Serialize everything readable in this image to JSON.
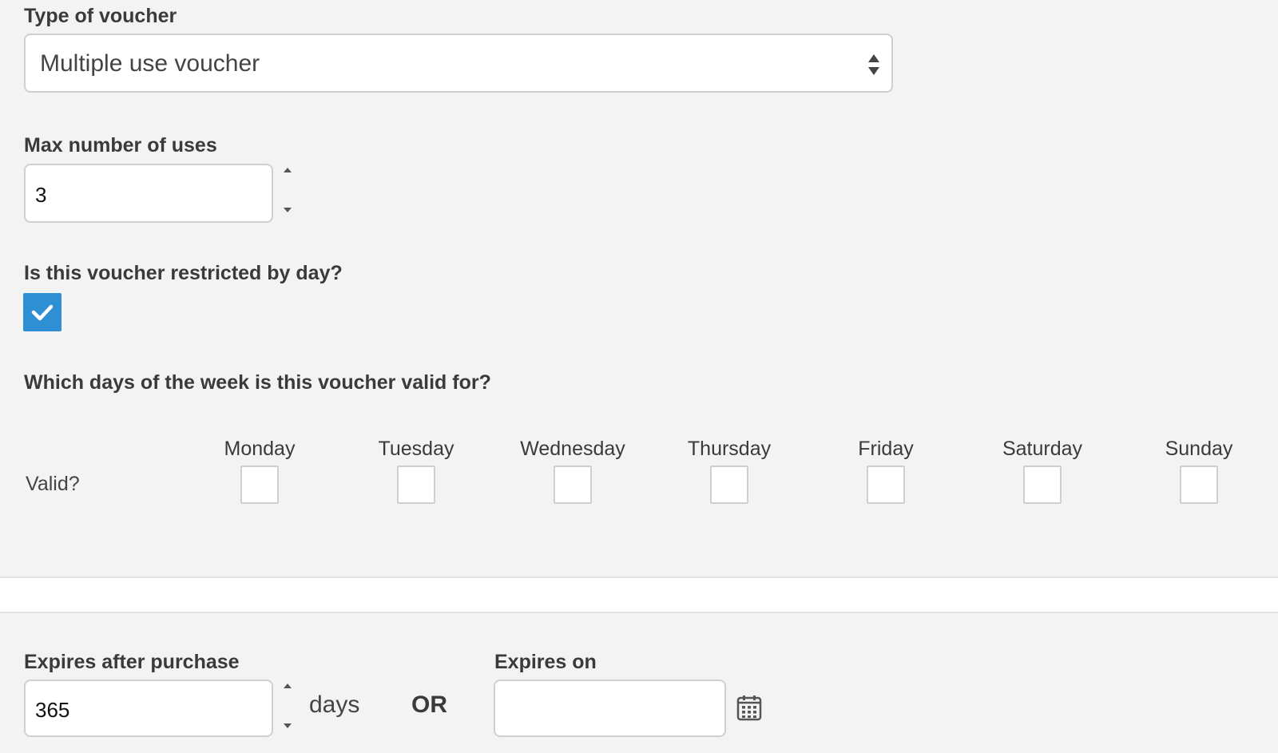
{
  "voucher_type": {
    "label": "Type of voucher",
    "selected": "Multiple use voucher"
  },
  "max_uses": {
    "label": "Max number of uses",
    "value": "3"
  },
  "day_restriction": {
    "label": "Is this voucher restricted by day?",
    "checked": true
  },
  "valid_days": {
    "label": "Which days of the week is this voucher valid for?",
    "row_label": "Valid?",
    "days": [
      {
        "name": "Monday",
        "checked": false
      },
      {
        "name": "Tuesday",
        "checked": false
      },
      {
        "name": "Wednesday",
        "checked": false
      },
      {
        "name": "Thursday",
        "checked": false
      },
      {
        "name": "Friday",
        "checked": false
      },
      {
        "name": "Saturday",
        "checked": false
      },
      {
        "name": "Sunday",
        "checked": false
      }
    ]
  },
  "expiry": {
    "after_purchase_label": "Expires after purchase",
    "after_purchase_value": "365",
    "unit": "days",
    "or": "OR",
    "expires_on_label": "Expires on",
    "expires_on_value": ""
  },
  "icons": {
    "select_arrows": "updown-arrows-icon",
    "spinner_up": "caret-up-icon",
    "spinner_down": "caret-down-icon",
    "checkmark": "checkmark-icon",
    "calendar": "calendar-icon"
  },
  "colors": {
    "page_background": "#f3f3f3",
    "checkbox_checked": "#2f8fd4",
    "border": "#cfcfcf"
  }
}
